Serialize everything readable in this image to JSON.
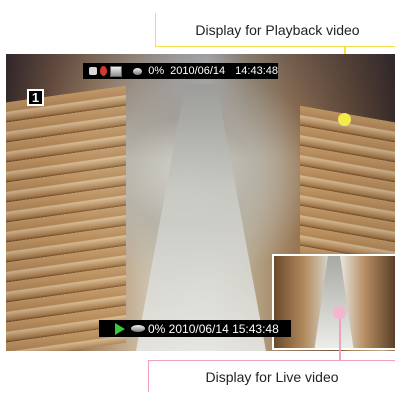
{
  "callouts": {
    "playback": "Display for Playback video",
    "live": "Display for Live video"
  },
  "playback_osd": {
    "icons": [
      "camera-icon",
      "record-icon",
      "monitor-icon",
      "disk-icon"
    ],
    "disk_usage": "0%",
    "date": "2010/06/14",
    "time": "14:43:48"
  },
  "live_osd": {
    "icons": [
      "play-icon",
      "disk-icon"
    ],
    "text": "0% 2010/06/14  15:43:48"
  },
  "channel": "1",
  "colors": {
    "playback_callout": "#f2e24a",
    "live_callout": "#f0a0c0",
    "play_icon": "#38c838",
    "record_icon": "#d2382c"
  }
}
